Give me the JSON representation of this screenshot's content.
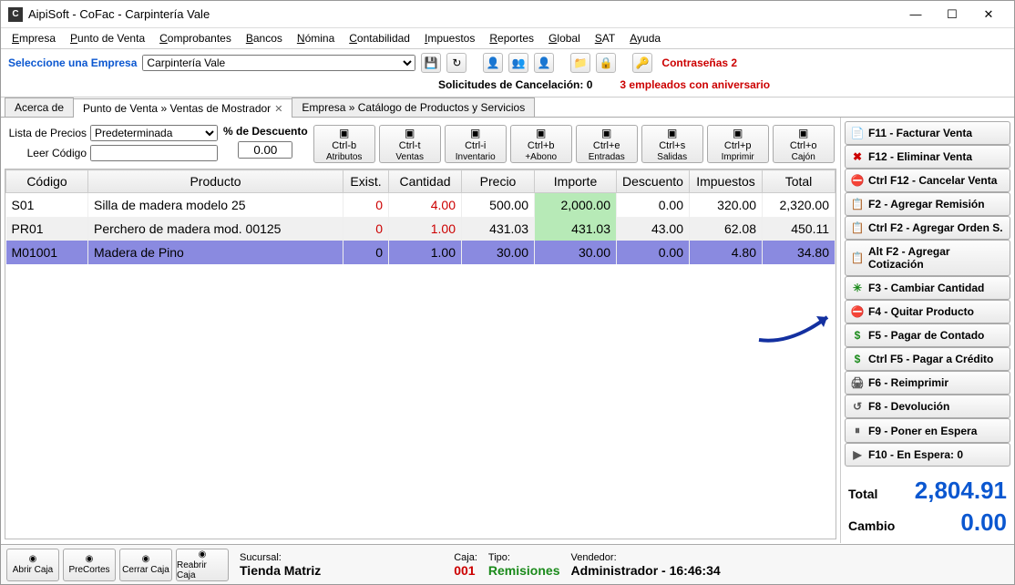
{
  "title": "AipiSoft - CoFac - Carpintería Vale",
  "menubar": [
    "Empresa",
    "Punto de Venta",
    "Comprobantes",
    "Bancos",
    "Nómina",
    "Contabilidad",
    "Impuestos",
    "Reportes",
    "Global",
    "SAT",
    "Ayuda"
  ],
  "company": {
    "label": "Seleccione una Empresa",
    "value": "Carpintería Vale",
    "extra1": "Contraseñas 2"
  },
  "statusline": {
    "cancel": "Solicitudes de Cancelación: 0",
    "anniv": "3 empleados con aniversario"
  },
  "tabs": [
    {
      "label": "Acerca de",
      "active": false,
      "closable": false
    },
    {
      "label": "Punto de Venta » Ventas de Mostrador",
      "active": true,
      "closable": true
    },
    {
      "label": "Empresa » Catálogo de Productos y Servicios",
      "active": false,
      "closable": false
    }
  ],
  "controls": {
    "priceListLabel": "Lista de Precios",
    "priceListValue": "Predeterminada",
    "codeLabel": "Leer Código",
    "discountLabel": "% de Descuento",
    "discountValue": "0.00",
    "bigButtons": [
      {
        "k": "Ctrl-b",
        "t": "Atributos"
      },
      {
        "k": "Ctrl-t",
        "t": "Ventas"
      },
      {
        "k": "Ctrl-i",
        "t": "Inventario"
      },
      {
        "k": "Ctrl+b",
        "t": "+Abono"
      },
      {
        "k": "Ctrl+e",
        "t": "Entradas"
      },
      {
        "k": "Ctrl+s",
        "t": "Salidas"
      },
      {
        "k": "Ctrl+p",
        "t": "Imprimir"
      },
      {
        "k": "Ctrl+o",
        "t": "Cajón"
      }
    ]
  },
  "grid": {
    "headers": [
      "Código",
      "Producto",
      "Exist.",
      "Cantidad",
      "Precio",
      "Importe",
      "Descuento",
      "Impuestos",
      "Total"
    ],
    "rows": [
      {
        "codigo": "S01",
        "producto": "Silla de madera modelo 25",
        "exist": "0",
        "cant": "4.00",
        "precio": "500.00",
        "importe": "2,000.00",
        "desc": "0.00",
        "imp": "320.00",
        "total": "2,320.00",
        "sel": false
      },
      {
        "codigo": "PR01",
        "producto": "Perchero de madera mod. 00125",
        "exist": "0",
        "cant": "1.00",
        "precio": "431.03",
        "importe": "431.03",
        "desc": "43.00",
        "imp": "62.08",
        "total": "450.11",
        "sel": false
      },
      {
        "codigo": "M01001",
        "producto": "Madera de Pino",
        "exist": "0",
        "cant": "1.00",
        "precio": "30.00",
        "importe": "30.00",
        "desc": "0.00",
        "imp": "4.80",
        "total": "34.80",
        "sel": true
      }
    ]
  },
  "actions": [
    {
      "ic": "📄",
      "t": "F11 - Facturar Venta"
    },
    {
      "ic": "✖",
      "t": "F12 - Eliminar Venta",
      "c": "#c00"
    },
    {
      "ic": "⛔",
      "t": "Ctrl F12 - Cancelar Venta",
      "c": "#c00"
    },
    {
      "ic": "📋",
      "t": "F2 - Agregar Remisión"
    },
    {
      "ic": "📋",
      "t": "Ctrl F2 - Agregar Orden S."
    },
    {
      "ic": "📋",
      "t": "Alt F2 - Agregar Cotización"
    },
    {
      "ic": "✳",
      "t": "F3 - Cambiar Cantidad",
      "c": "#1a8a1a"
    },
    {
      "ic": "⛔",
      "t": "F4 - Quitar Producto",
      "c": "#c00"
    },
    {
      "ic": "$",
      "t": "F5 - Pagar de Contado",
      "c": "#1a8a1a"
    },
    {
      "ic": "$",
      "t": "Ctrl F5 - Pagar a Crédito",
      "c": "#1a8a1a"
    },
    {
      "ic": "🖨",
      "t": "F6 - Reimprimir"
    },
    {
      "ic": "↺",
      "t": "F8 - Devolución"
    },
    {
      "ic": "⏸",
      "t": "F9 - Poner en Espera"
    },
    {
      "ic": "▶",
      "t": "F10 - En Espera: 0"
    }
  ],
  "totals": {
    "totalLabel": "Total",
    "totalValue": "2,804.91",
    "changeLabel": "Cambio",
    "changeValue": "0.00"
  },
  "bottom": {
    "buttons": [
      {
        "t": "Abrir Caja"
      },
      {
        "t": "PreCortes"
      },
      {
        "t": "Cerrar Caja"
      },
      {
        "t": "Reabrir Caja"
      }
    ],
    "sucursalLabel": "Sucursal:",
    "sucursal": "Tienda Matriz",
    "cajaLabel": "Caja:",
    "caja": "001",
    "tipoLabel": "Tipo:",
    "tipo": "Remisiones",
    "vendLabel": "Vendedor:",
    "vendedor": "Administrador - 16:46:34"
  }
}
